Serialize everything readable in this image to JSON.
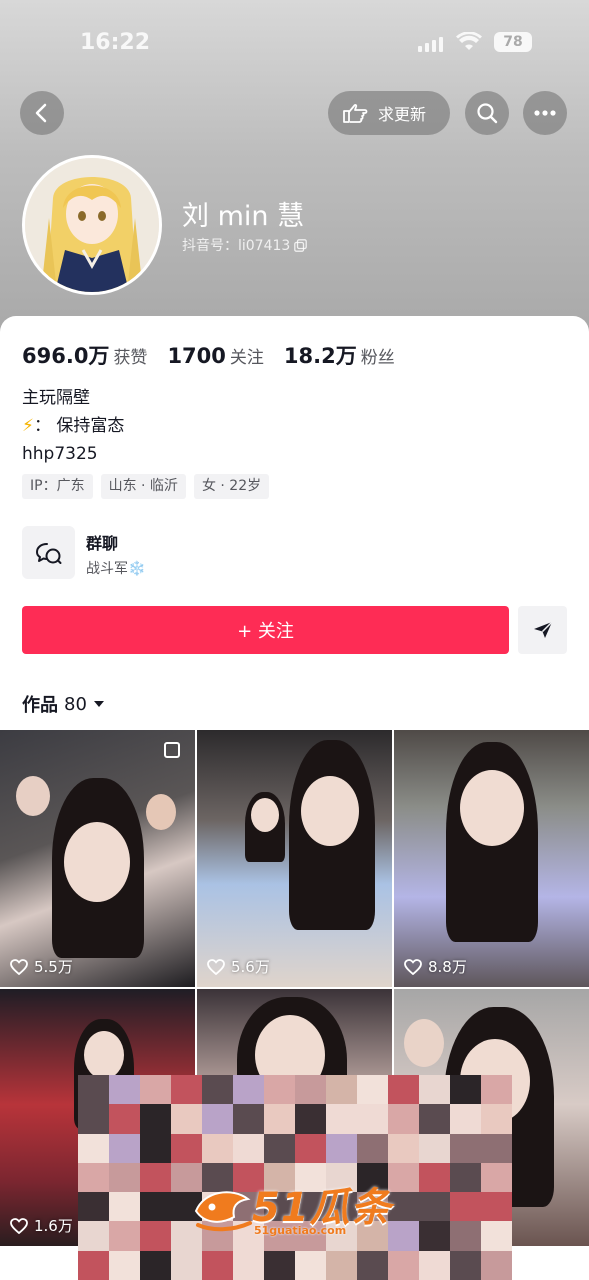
{
  "status_bar": {
    "time": "16:22",
    "battery": "78"
  },
  "header": {
    "update_label": "求更新",
    "icons": {
      "back": "chevron-left-icon",
      "hand": "pointing-hand-icon",
      "search": "search-icon",
      "more": "more-dots-icon"
    }
  },
  "profile": {
    "nickname": "刘 min 慧",
    "douyin_id": "抖音号：li07413",
    "avatar": "anime-avatar"
  },
  "stats": [
    {
      "value": "696.0万",
      "label": "获赞"
    },
    {
      "value": "1700",
      "label": "关注"
    },
    {
      "value": "18.2万",
      "label": "粉丝"
    }
  ],
  "bio": {
    "line1": "主玩隔壁",
    "line2_emoji": "⚡",
    "line2": "： 保持富态",
    "line3": "hhp7325"
  },
  "tags": [
    "IP：广东",
    "山东 · 临沂",
    "女 · 22岁"
  ],
  "group": {
    "title": "群聊",
    "subtitle": "战斗军❄️"
  },
  "actions": {
    "follow_label": "+ 关注"
  },
  "works": {
    "label": "作品",
    "count": "80"
  },
  "videos": [
    {
      "likes": "5.5万"
    },
    {
      "likes": "5.6万"
    },
    {
      "likes": "8.8万"
    },
    {
      "likes": "1.6万"
    },
    {
      "likes": ""
    },
    {
      "likes": ""
    }
  ],
  "watermark": {
    "logo": "51瓜条",
    "url": "51guatiao.com"
  },
  "colors": {
    "accent": "#fe2c55",
    "watermark": "#f07b1e"
  }
}
